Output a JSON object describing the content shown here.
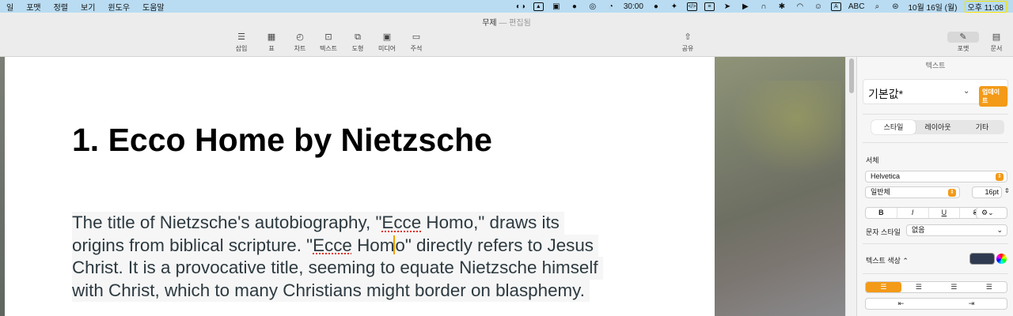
{
  "menubar": {
    "items": [
      "일",
      "포맷",
      "정렬",
      "보기",
      "윈도우",
      "도움말"
    ],
    "timer": "30:00",
    "input_source": "A",
    "abc": "ABC",
    "date": "10월 16일 (월)",
    "time": "오후 11:08"
  },
  "window": {
    "title": "무제",
    "subtitle": "편집됨"
  },
  "toolbar": {
    "insert": "삽입",
    "table": "표",
    "chart": "차트",
    "text": "텍스트",
    "shape": "도형",
    "media": "미디어",
    "comment": "주석",
    "share": "공유",
    "format": "포맷",
    "document": "문서"
  },
  "document": {
    "heading": "1. Ecco Home by Nietzsche",
    "lines": [
      [
        "The title of Nietzsche's autobiography, \"",
        "Ecce",
        " Homo,\" draws its "
      ],
      [
        "origins from biblical scripture. \"",
        "Ecce",
        " Hom",
        "o\" directly refers to Jesus"
      ],
      [
        "Christ. It is a provocative title, seeming to equate Nietzsche himself"
      ],
      [
        "with Christ, which to many Christians might border on blasphemy."
      ]
    ]
  },
  "inspector": {
    "title": "텍스트",
    "paragraph_style": "기본값*",
    "update_button": "업데이트",
    "tabs": [
      "스타일",
      "레이아웃",
      "기타"
    ],
    "font_section": "서체",
    "font_family": "Helvetica",
    "font_weight": "일반체",
    "font_size": "16pt",
    "bold": "B",
    "italic": "I",
    "underline": "U",
    "strike": "S",
    "char_style_label": "문자 스타일",
    "char_style_value": "없음",
    "text_color_label": "텍스트 색상 ⌃",
    "text_color": "#2f3a50",
    "accent": "#f39a18"
  }
}
